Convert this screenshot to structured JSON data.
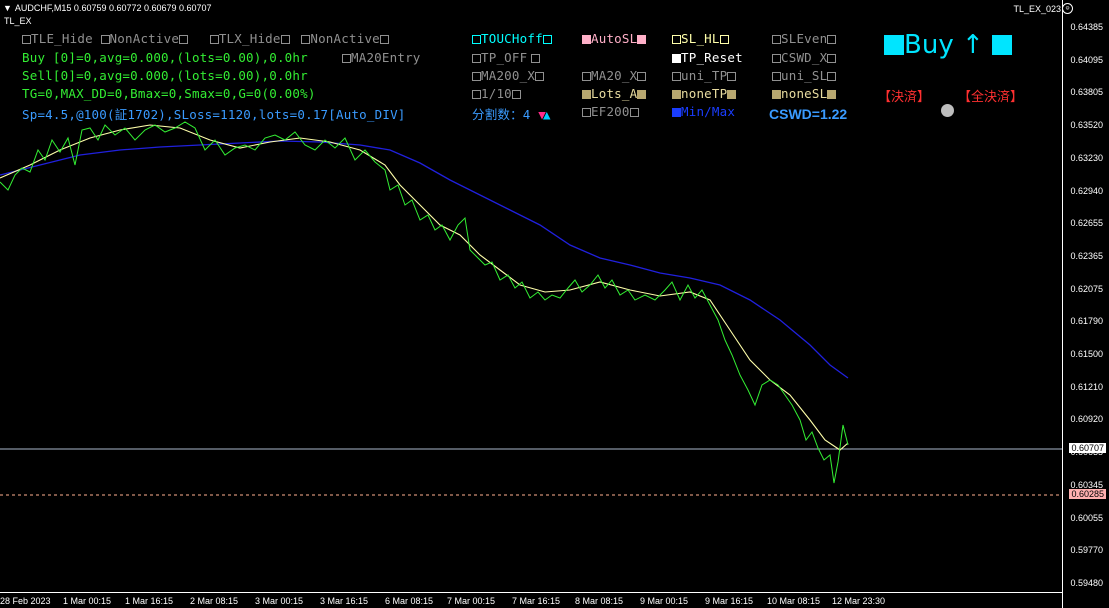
{
  "header": {
    "symbol_line": "AUDCHF,M15  0.60759 0.60772 0.60679 0.60707",
    "indicator": "TL_EX",
    "ea_name": "TL_EX_023"
  },
  "panel": {
    "row1": [
      "TLE_Hide",
      "NonActive",
      "TLX_Hide",
      "NonActive"
    ],
    "buy_line": "Buy [0]=0,avg=0.000,(lots=0.00),0.0hr",
    "sell_line": "Sell[0]=0,avg=0.000,(lots=0.00),0.0hr",
    "ma20entry": "MA20Entry",
    "tg_line": "TG=0,MAX_DD=0,Bmax=0,Smax=0,G=0(0.00%)",
    "sp_line": "Sp=4.5,@100(証1702),SLoss=1120,lots=0.17[Auto_DIV]",
    "touch": "TOUCHoff",
    "autosl": "AutoSL",
    "sl_hl": "SL_HL",
    "sleven": "SLEven",
    "tp_off": "TP_OFF",
    "tp_reset": "TP_Reset",
    "cswd_x": "CSWD_X",
    "ma200x": "MA200_X",
    "ma20x": "MA20_X",
    "uni_tp": "uni_TP",
    "uni_sl": "uni_SL",
    "one_ten": "1/10",
    "lots_a": "Lots_A",
    "none_tp": "noneTP",
    "none_sl": "noneSL",
    "div_label": "分割数：4",
    "ef200": "EF200",
    "minmax": "Min/Max",
    "buy_big": "Buy ↑",
    "settle": "【決済】",
    "settle_all": "【全決済】",
    "cswd": "CSWD=1.22"
  },
  "price_axis": [
    "0.64385",
    "0.64095",
    "0.63805",
    "0.63520",
    "0.63230",
    "0.62940",
    "0.62655",
    "0.62365",
    "0.62075",
    "0.61790",
    "0.61500",
    "0.61210",
    "0.60920",
    "0.60635",
    "0.60345",
    "0.60055",
    "0.59770",
    "0.59480"
  ],
  "current_price": "0.60707",
  "stop_price": "0.60285",
  "time_axis": [
    "28 Feb 2023",
    "1 Mar 00:15",
    "1 Mar 16:15",
    "2 Mar 08:15",
    "3 Mar 00:15",
    "3 Mar 16:15",
    "6 Mar 08:15",
    "7 Mar 00:15",
    "7 Mar 16:15",
    "8 Mar 08:15",
    "9 Mar 00:15",
    "9 Mar 16:15",
    "10 Mar 08:15",
    "12 Mar 23:30"
  ],
  "colors": {
    "price": "#33ee33",
    "ma20": "#ffffaa",
    "ma200": "#2020dd",
    "stop": "#ffb090",
    "bid": "#aab8cc"
  }
}
